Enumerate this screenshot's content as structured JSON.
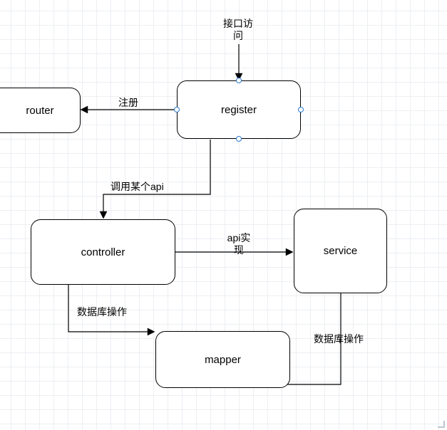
{
  "boxes": {
    "router": "router",
    "register": "register",
    "controller": "controller",
    "service": "service",
    "mapper": "mapper"
  },
  "edges": {
    "access": "接口访\n问",
    "register": "注册",
    "callapi": "调用某个api",
    "apiimpl": "api实\n现",
    "dbop1": "数据库操作",
    "dbop2": "数据库操作"
  }
}
